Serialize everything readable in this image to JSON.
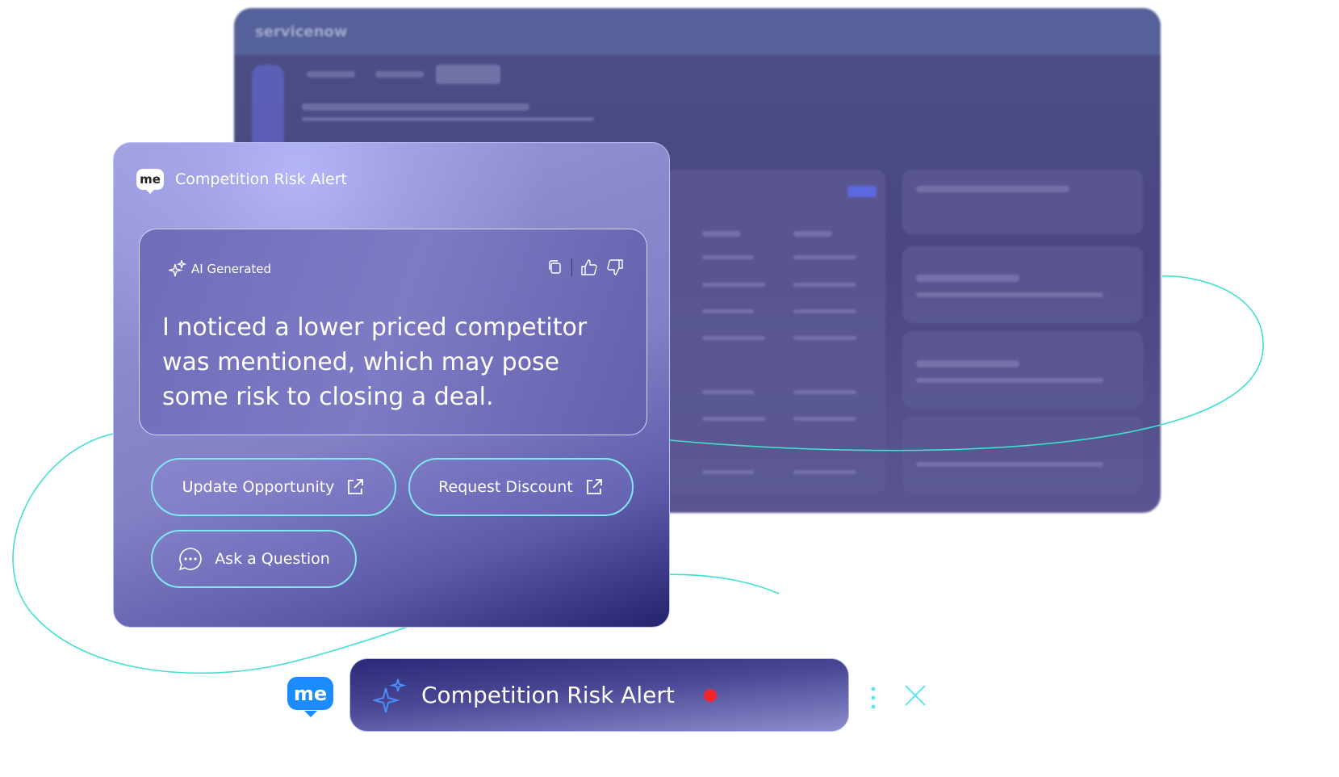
{
  "background_app": {
    "brand": "servicenow"
  },
  "card": {
    "title": "Competition Risk Alert",
    "badge": "AI Generated",
    "message": "I noticed a lower priced competitor was mentioned, which may pose some risk to closing a deal.",
    "actions": [
      {
        "label": "Update Opportunity",
        "icon": "external-link-icon"
      },
      {
        "label": "Request Discount",
        "icon": "external-link-icon"
      },
      {
        "label": "Ask a Question",
        "icon": "chat-bubble-icon"
      }
    ],
    "tools": [
      "copy-icon",
      "thumbs-up-icon",
      "thumbs-down-icon"
    ]
  },
  "notification": {
    "logo": "me",
    "title": "Competition Risk Alert",
    "status_color": "#f2262b"
  },
  "colors": {
    "accent": "#7fe8f3",
    "brand": "#1a8cff"
  }
}
